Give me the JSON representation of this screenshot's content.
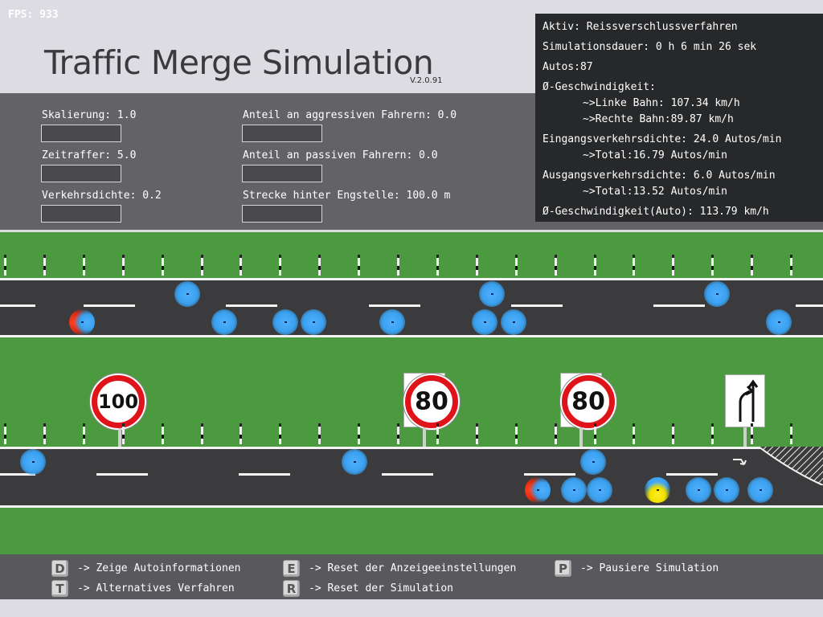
{
  "fps": "FPS: 933",
  "title": "Traffic Merge Simulation",
  "version": "V.2.0.91",
  "settings": [
    {
      "label": "Skalierung: 1.0"
    },
    {
      "label": "Zeitraffer: 5.0"
    },
    {
      "label": "Verkehrsdichte: 0.2"
    },
    {
      "label": "Anteil an aggressiven Fahrern: 0.0"
    },
    {
      "label": "Anteil an passiven Fahrern: 0.0"
    },
    {
      "label": "Strecke hinter Engstelle: 100.0 m"
    }
  ],
  "info": {
    "aktiv": "Aktiv: Reissverschlussverfahren",
    "dauer": "Simulationsdauer: 0 h 6 min 26 sek",
    "autos": "Autos:87",
    "geschw_header": "Ø-Geschwindigkeit:",
    "linke": "~>Linke Bahn: 107.34 km/h",
    "rechte": "~>Rechte Bahn:89.87 km/h",
    "eingang": "Eingangsverkehrsdichte: 24.0 Autos/min",
    "eingang_total": "~>Total:16.79 Autos/min",
    "ausgang": "Ausgangsverkehrsdichte: 6.0 Autos/min",
    "ausgang_total": "~>Total:13.52 Autos/min",
    "auto_speed": "Ø-Geschwindigkeit(Auto): 113.79 km/h"
  },
  "signs": {
    "limit_100": "100",
    "limit_80_a": "80",
    "limit_80_b": "80"
  },
  "colors": {
    "car": "#3aa0ee",
    "car_red": "#e02a10",
    "car_yellow": "#f0e000",
    "grass": "#4c9a3f",
    "asphalt": "#3b3b3d",
    "sign_red": "#e0121a"
  },
  "keys": [
    {
      "key": "D",
      "action": "-> Zeige Autoinformationen"
    },
    {
      "key": "T",
      "action": "-> Alternatives Verfahren"
    },
    {
      "key": "E",
      "action": "-> Reset der Anzeigeeinstellungen"
    },
    {
      "key": "R",
      "action": "-> Reset der Simulation"
    },
    {
      "key": "P",
      "action": "-> Pausiere Simulation"
    }
  ]
}
